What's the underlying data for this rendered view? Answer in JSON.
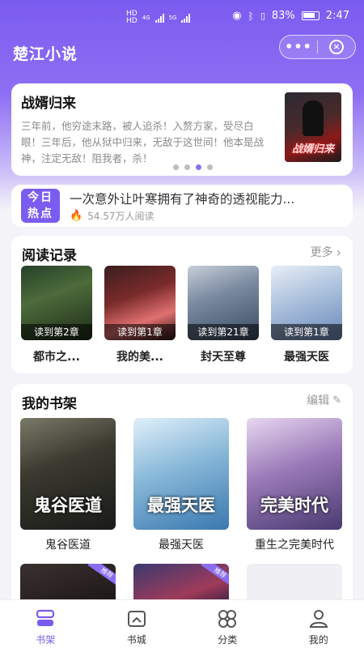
{
  "status_bar": {
    "network_1": "HD",
    "network_2": "HD",
    "net_type_1": "4G",
    "net_type_2": "5G",
    "battery": "83%",
    "time": "2:47"
  },
  "header": {
    "title": "楚江小说",
    "more_label": "•••",
    "close_label": "×"
  },
  "banner": {
    "title": "战婿归来",
    "description": "三年前，他穷途末路，被人追杀！入赘方家，受尽白眼！三年后，他从狱中归来，无敌于这世间！他本是战神，注定无敌！阻我者，杀！",
    "cover_text": "战婿归来",
    "dots": 4,
    "active_dot": 2
  },
  "hot": {
    "badge_line1": "今日",
    "badge_line2": "热点",
    "title": "一次意外让叶寒拥有了神奇的透视能力...",
    "readers": "54.57万人阅读"
  },
  "history": {
    "title": "阅读记录",
    "more_label": "更多",
    "items": [
      {
        "name": "都市之...",
        "progress": "读到第2章"
      },
      {
        "name": "我的美...",
        "progress": "读到第1章"
      },
      {
        "name": "封天至尊",
        "progress": "读到第21章"
      },
      {
        "name": "最强天医",
        "progress": "读到第1章"
      }
    ]
  },
  "shelf": {
    "title": "我的书架",
    "edit_label": "编辑",
    "books": [
      {
        "name": "鬼谷医道",
        "cover_text": "鬼谷医道"
      },
      {
        "name": "最强天医",
        "cover_text": "最强天医"
      },
      {
        "name": "重生之完美时代",
        "cover_text": "完美时代"
      }
    ],
    "row2_tag": "推荐"
  },
  "nav": {
    "items": [
      {
        "label": "书架",
        "icon": "bookshelf-icon"
      },
      {
        "label": "书城",
        "icon": "bookstore-icon"
      },
      {
        "label": "分类",
        "icon": "category-icon"
      },
      {
        "label": "我的",
        "icon": "profile-icon"
      }
    ],
    "active_index": 0,
    "accent": "#7b5cf0"
  }
}
